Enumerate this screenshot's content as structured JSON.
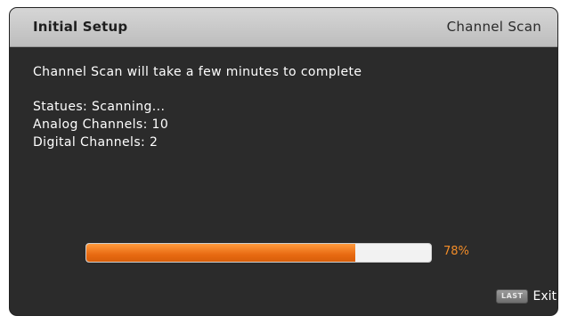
{
  "header": {
    "title": "Initial Setup",
    "section": "Channel Scan"
  },
  "message": "Channel Scan will take a few minutes to complete",
  "status": {
    "status_line": "Statues: Scanning...",
    "analog_line": "Analog Channels: 10",
    "digital_line": "Digital Channels: 2"
  },
  "progress": {
    "value": 0.78,
    "label": "78%",
    "color": "#f28c28"
  },
  "footer": {
    "key_label": "LAST",
    "exit_label": "Exit"
  }
}
